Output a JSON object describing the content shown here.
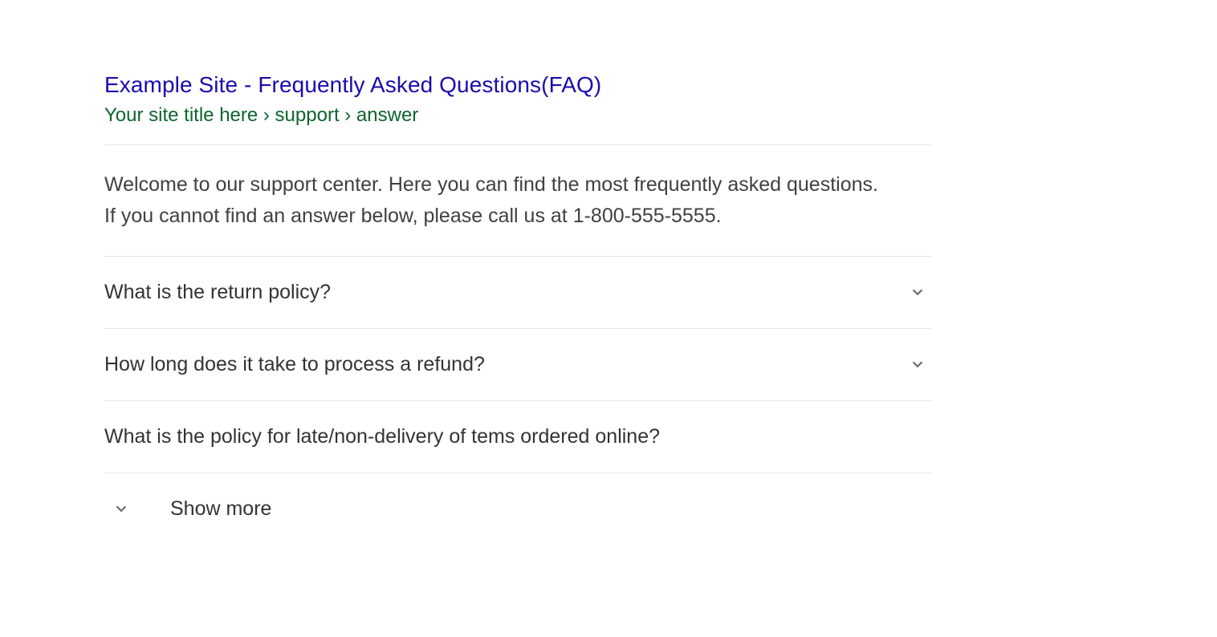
{
  "result": {
    "title": "Example Site - Frequently Asked Questions(FAQ)",
    "breadcrumb": "Your site title here › support › answer",
    "description_line1": "Welcome to our support center. Here you can find the most frequently asked questions.",
    "description_line2": "If you cannot find an answer below, please call us at 1-800-555-5555."
  },
  "faq": {
    "items": [
      {
        "question": "What is the return policy?",
        "has_chevron": true
      },
      {
        "question": "How long does it take to process a refund?",
        "has_chevron": true
      },
      {
        "question": "What is the policy for late/non-delivery of  tems ordered online?",
        "has_chevron": false
      }
    ],
    "show_more_label": "Show more"
  }
}
